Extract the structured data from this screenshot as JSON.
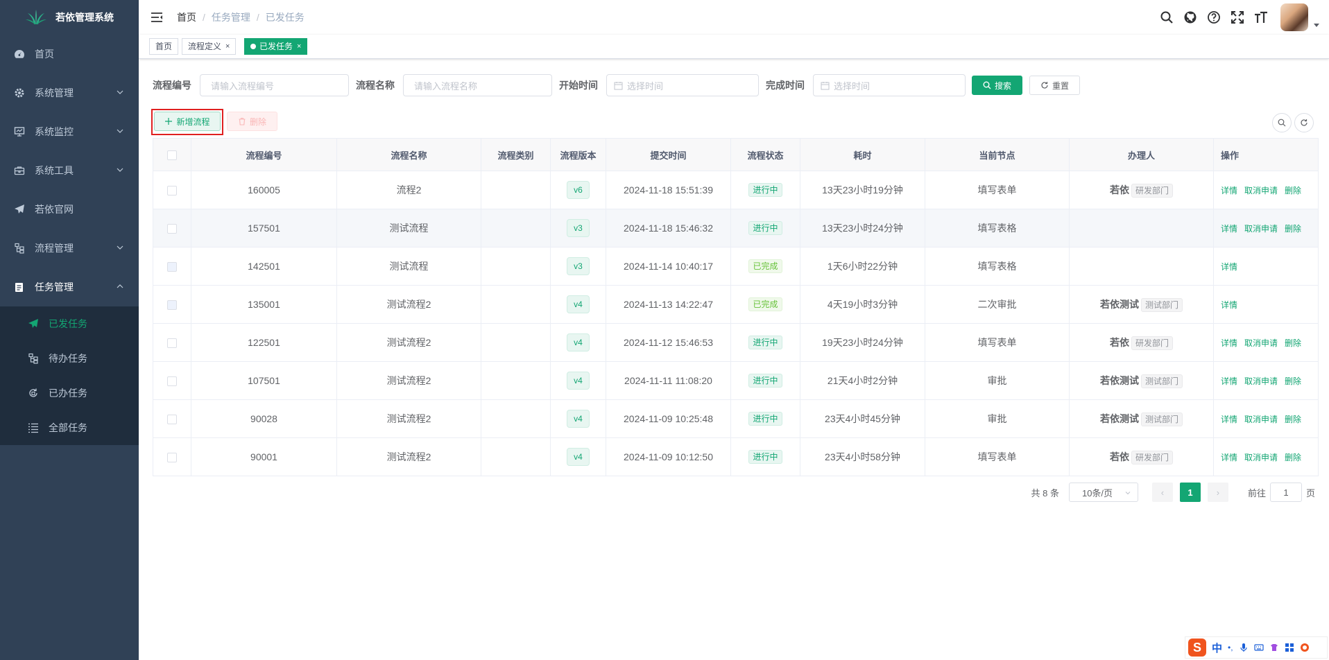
{
  "app": {
    "title": "若依管理系统"
  },
  "sidebar": {
    "items": [
      {
        "label": "首页",
        "icon": "dashboard-icon"
      },
      {
        "label": "系统管理",
        "icon": "gear-icon"
      },
      {
        "label": "系统监控",
        "icon": "monitor-icon"
      },
      {
        "label": "系统工具",
        "icon": "toolbox-icon"
      },
      {
        "label": "若依官网",
        "icon": "paper-plane-icon"
      },
      {
        "label": "流程管理",
        "icon": "flow-icon"
      },
      {
        "label": "任务管理",
        "icon": "clipboard-icon"
      }
    ],
    "task_submenu": [
      {
        "label": "已发任务",
        "icon": "paper-plane-icon"
      },
      {
        "label": "待办任务",
        "icon": "flow-icon"
      },
      {
        "label": "已办任务",
        "icon": "refresh-doc-icon"
      },
      {
        "label": "全部任务",
        "icon": "list-icon"
      }
    ]
  },
  "navbar": {
    "breadcrumb": [
      "首页",
      "任务管理",
      "已发任务"
    ],
    "separator": "/"
  },
  "tags": [
    {
      "label": "首页"
    },
    {
      "label": "流程定义",
      "close": "×"
    },
    {
      "label": "已发任务",
      "close": "×"
    }
  ],
  "search": {
    "code_label": "流程编号",
    "code_placeholder": "请输入流程编号",
    "name_label": "流程名称",
    "name_placeholder": "请输入流程名称",
    "start_label": "开始时间",
    "start_placeholder": "选择时间",
    "end_label": "完成时间",
    "end_placeholder": "选择时间",
    "search_btn": "搜索",
    "reset_btn": "重置"
  },
  "toolbar": {
    "add_btn": "新增流程",
    "delete_btn": "删除"
  },
  "table": {
    "headers": [
      "流程编号",
      "流程名称",
      "流程类别",
      "流程版本",
      "提交时间",
      "流程状态",
      "耗时",
      "当前节点",
      "办理人",
      "操作"
    ],
    "rows": [
      {
        "code": "160005",
        "name": "流程2",
        "category": "",
        "version": "v6",
        "time": "2024-11-18 15:51:39",
        "status": "进行中",
        "status_type": "running",
        "duration": "13天23小时19分钟",
        "node": "填写表单",
        "assignee": "若依",
        "dept": "研发部门",
        "ops": [
          "详情",
          "取消申请",
          "删除"
        ]
      },
      {
        "code": "157501",
        "name": "测试流程",
        "category": "",
        "version": "v3",
        "time": "2024-11-18 15:46:32",
        "status": "进行中",
        "status_type": "running",
        "duration": "13天23小时24分钟",
        "node": "填写表格",
        "assignee": "",
        "dept": "",
        "ops": [
          "详情",
          "取消申请",
          "删除"
        ]
      },
      {
        "code": "142501",
        "name": "测试流程",
        "category": "",
        "version": "v3",
        "time": "2024-11-14 10:40:17",
        "status": "已完成",
        "status_type": "done",
        "duration": "1天6小时22分钟",
        "node": "填写表格",
        "assignee": "",
        "dept": "",
        "ops": [
          "详情"
        ]
      },
      {
        "code": "135001",
        "name": "测试流程2",
        "category": "",
        "version": "v4",
        "time": "2024-11-13 14:22:47",
        "status": "已完成",
        "status_type": "done",
        "duration": "4天19小时3分钟",
        "node": "二次审批",
        "assignee": "若依测试",
        "dept": "测试部门",
        "ops": [
          "详情"
        ]
      },
      {
        "code": "122501",
        "name": "测试流程2",
        "category": "",
        "version": "v4",
        "time": "2024-11-12 15:46:53",
        "status": "进行中",
        "status_type": "running",
        "duration": "19天23小时24分钟",
        "node": "填写表单",
        "assignee": "若依",
        "dept": "研发部门",
        "ops": [
          "详情",
          "取消申请",
          "删除"
        ]
      },
      {
        "code": "107501",
        "name": "测试流程2",
        "category": "",
        "version": "v4",
        "time": "2024-11-11 11:08:20",
        "status": "进行中",
        "status_type": "running",
        "duration": "21天4小时2分钟",
        "node": "审批",
        "assignee": "若依测试",
        "dept": "测试部门",
        "ops": [
          "详情",
          "取消申请",
          "删除"
        ]
      },
      {
        "code": "90028",
        "name": "测试流程2",
        "category": "",
        "version": "v4",
        "time": "2024-11-09 10:25:48",
        "status": "进行中",
        "status_type": "running",
        "duration": "23天4小时45分钟",
        "node": "审批",
        "assignee": "若依测试",
        "dept": "测试部门",
        "ops": [
          "详情",
          "取消申请",
          "删除"
        ]
      },
      {
        "code": "90001",
        "name": "测试流程2",
        "category": "",
        "version": "v4",
        "time": "2024-11-09 10:12:50",
        "status": "进行中",
        "status_type": "running",
        "duration": "23天4小时58分钟",
        "node": "填写表单",
        "assignee": "若依",
        "dept": "研发部门",
        "ops": [
          "详情",
          "取消申请",
          "删除"
        ]
      }
    ]
  },
  "pagination": {
    "total_text": "共 8 条",
    "page_size": "10条/页",
    "current_page": "1",
    "prev": "‹",
    "next": "›",
    "goto_label": "前往",
    "goto_value": "1",
    "page_suffix": "页"
  },
  "ime": {
    "logo": "S",
    "lang": "中",
    "punct": "•,"
  },
  "colors": {
    "primary": "#13a673",
    "sidebar_bg": "#304156",
    "submenu_bg": "#1f2d3d",
    "danger": "#f56c6c"
  }
}
